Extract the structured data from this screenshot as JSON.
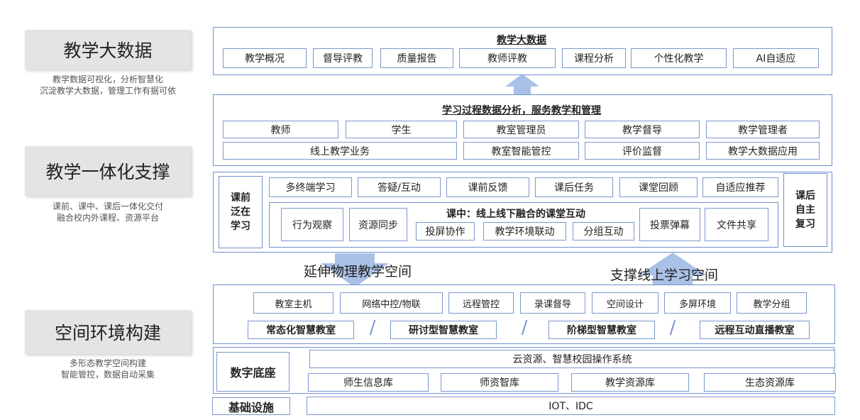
{
  "side": {
    "top": {
      "title": "教学大数据",
      "desc1": "教学数据可视化，分析智慧化",
      "desc2": "沉淀教学大数据，管理工作有据可依"
    },
    "mid": {
      "title": "教学一体化支撑",
      "desc1": "课前、课中、课后一体化交付",
      "desc2": "融合校内外课程、资源平台"
    },
    "bot": {
      "title": "空间环境构建",
      "desc1": "多形态教学空间构建",
      "desc2": "智能管控，数据自动采集"
    }
  },
  "bigdata": {
    "header": "教学大数据",
    "items": [
      "教学概况",
      "督导评教",
      "质量报告",
      "教师评教",
      "课程分析",
      "个性化教学",
      "AI自适应"
    ]
  },
  "process": {
    "header": "学习过程数据分析，服务教学和管理",
    "row1": [
      "教师",
      "学生",
      "教室管理员",
      "教学督导",
      "教学管理者"
    ],
    "row2": [
      "线上教学业务",
      "教室智能管控",
      "评价监督",
      "教学大数据应用"
    ]
  },
  "integrated": {
    "pre": "课前\n泛在\n学习",
    "post": "课后\n自主\n复习",
    "top": [
      "多终端学习",
      "答疑/互动",
      "课前反馈",
      "课后任务",
      "课堂回顾",
      "自适应推荐"
    ],
    "inclass_header": "课中：线上线下融合的课堂互动",
    "inclass_left": [
      "行为观察",
      "资源同步"
    ],
    "inclass_mid": [
      "投屏协作",
      "教学环境联动",
      "分组互动"
    ],
    "inclass_right": [
      "投票弹幕",
      "文件共享"
    ]
  },
  "arrows": {
    "left": "延伸物理教学空间",
    "right": "支撑线上学习空间"
  },
  "space": {
    "row1": [
      "教室主机",
      "网络中控/物联",
      "远程管控",
      "录课督导",
      "空间设计",
      "多屏环境",
      "教学分组"
    ],
    "row2": [
      "常态化智慧教室",
      "研讨型智慧教室",
      "阶梯型智慧教室",
      "远程互动直播教室"
    ],
    "slash": "/"
  },
  "base": {
    "digital": "数字底座",
    "cloud": "云资源、智慧校园操作系统",
    "libs": [
      "师生信息库",
      "师资智库",
      "教学资源库",
      "生态资源库"
    ],
    "infra": "基础设施",
    "iot": "IOT、IDC"
  },
  "colors": {
    "border": "#6f8fcf",
    "arrow": "#a9c1e6",
    "sidebg": "#e4e4e4"
  }
}
